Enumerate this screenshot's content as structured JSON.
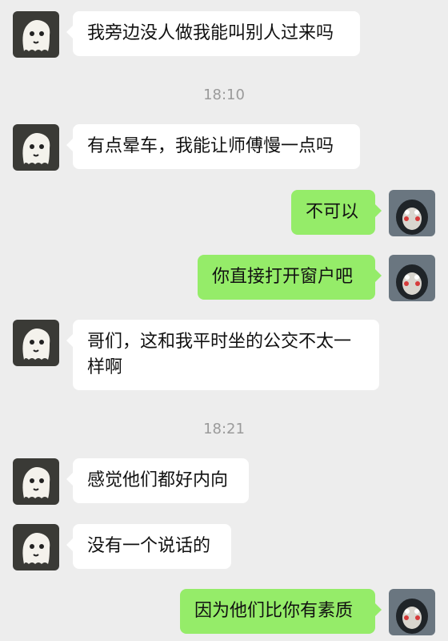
{
  "timestamps": [
    "18:10",
    "18:21"
  ],
  "messages": [
    {
      "side": "left",
      "text": "我旁边没人做我能叫别人过来吗"
    },
    {
      "side": "left",
      "text": "有点晕车，我能让师傅慢一点吗"
    },
    {
      "side": "right",
      "text": "不可以"
    },
    {
      "side": "right",
      "text": "你直接打开窗户吧"
    },
    {
      "side": "left",
      "text": "哥们，这和我平时坐的公交不太一样啊"
    },
    {
      "side": "left",
      "text": "感觉他们都好内向"
    },
    {
      "side": "left",
      "text": "没有一个说话的"
    },
    {
      "side": "right",
      "text": "因为他们比你有素质"
    }
  ],
  "colors": {
    "background": "#ededed",
    "left_bubble": "#ffffff",
    "right_bubble": "#95ec69"
  },
  "icons": {
    "left_avatar": "ghost-avatar-icon",
    "right_avatar": "penguin-avatar-icon"
  }
}
